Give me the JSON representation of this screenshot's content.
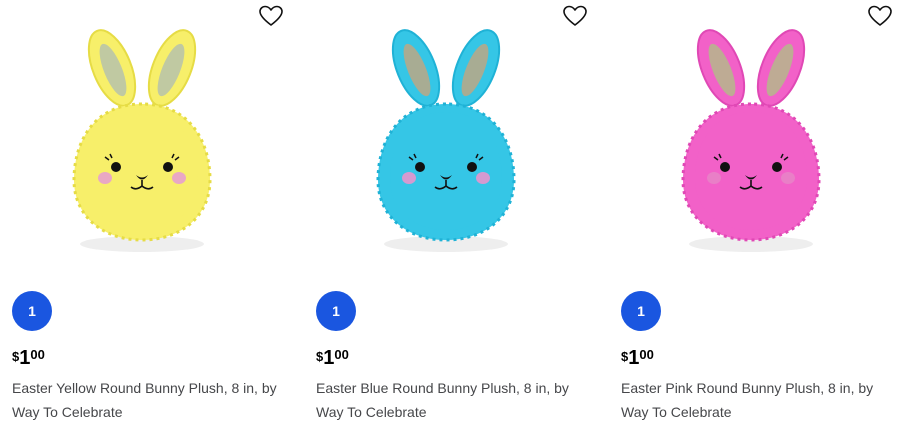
{
  "products": [
    {
      "quantity": "1",
      "price": {
        "currency": "$",
        "dollars": "1",
        "cents": "00"
      },
      "title": "Easter Yellow Round Bunny Plush, 8 in, by Way To Celebrate",
      "colors": {
        "fur": "#f7ef6a",
        "fur_dark": "#e6dc45",
        "ear_inner": "#b9c4a8",
        "cheek": "#e9a8c4"
      },
      "favorite_icon": "heart-outline-icon"
    },
    {
      "quantity": "1",
      "price": {
        "currency": "$",
        "dollars": "1",
        "cents": "00"
      },
      "title": "Easter Blue Round Bunny Plush, 8 in, by Way To Celebrate",
      "colors": {
        "fur": "#35c6e6",
        "fur_dark": "#1fb2d6",
        "ear_inner": "#b5a98a",
        "cheek": "#d59ad0"
      },
      "favorite_icon": "heart-outline-icon"
    },
    {
      "quantity": "1",
      "price": {
        "currency": "$",
        "dollars": "1",
        "cents": "00"
      },
      "title": "Easter Pink Round Bunny Plush, 8 in, by Way To Celebrate",
      "colors": {
        "fur": "#f261c8",
        "fur_dark": "#e048b5",
        "ear_inner": "#b8b48e",
        "cheek": "#e97fc7"
      },
      "favorite_icon": "heart-outline-icon"
    }
  ],
  "accent_color": "#1a56e0"
}
